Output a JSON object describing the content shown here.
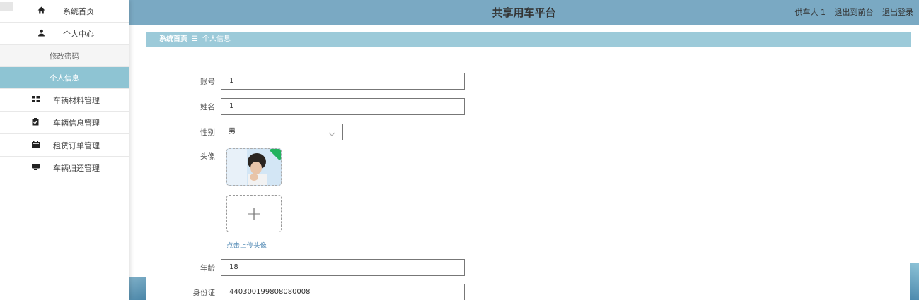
{
  "sidebar": {
    "items": [
      {
        "icon": "home-icon",
        "label": "系统首页"
      },
      {
        "icon": "user-icon",
        "label": "个人中心"
      }
    ],
    "sub_items": [
      {
        "label": "修改密码"
      },
      {
        "label": "个人信息"
      }
    ],
    "menu": [
      {
        "icon": "grid-icon",
        "label": "车辆材料管理"
      },
      {
        "icon": "clipboard-icon",
        "label": "车辆信息管理"
      },
      {
        "icon": "calendar-icon",
        "label": "租赁订单管理"
      },
      {
        "icon": "monitor-icon",
        "label": "车辆归还管理"
      }
    ]
  },
  "header": {
    "title": "共享用车平台",
    "user": "供车人 1",
    "links": [
      "退出到前台",
      "退出登录"
    ]
  },
  "breadcrumb": {
    "home": "系统首页",
    "separator": "☰",
    "current": "个人信息"
  },
  "form": {
    "account": {
      "label": "账号",
      "value": "1"
    },
    "name": {
      "label": "姓名",
      "value": "1"
    },
    "gender": {
      "label": "性别",
      "value": "男"
    },
    "avatar": {
      "label": "头像",
      "hint": "点击上传头像",
      "add": "+"
    },
    "age": {
      "label": "年龄",
      "value": "18"
    },
    "id_card": {
      "label": "身份证",
      "value": "440300199808080008"
    }
  },
  "colors": {
    "topbar": "#7aa9c3",
    "breadcrumb": "#9ccad9",
    "active_item": "#8ec4d3"
  }
}
